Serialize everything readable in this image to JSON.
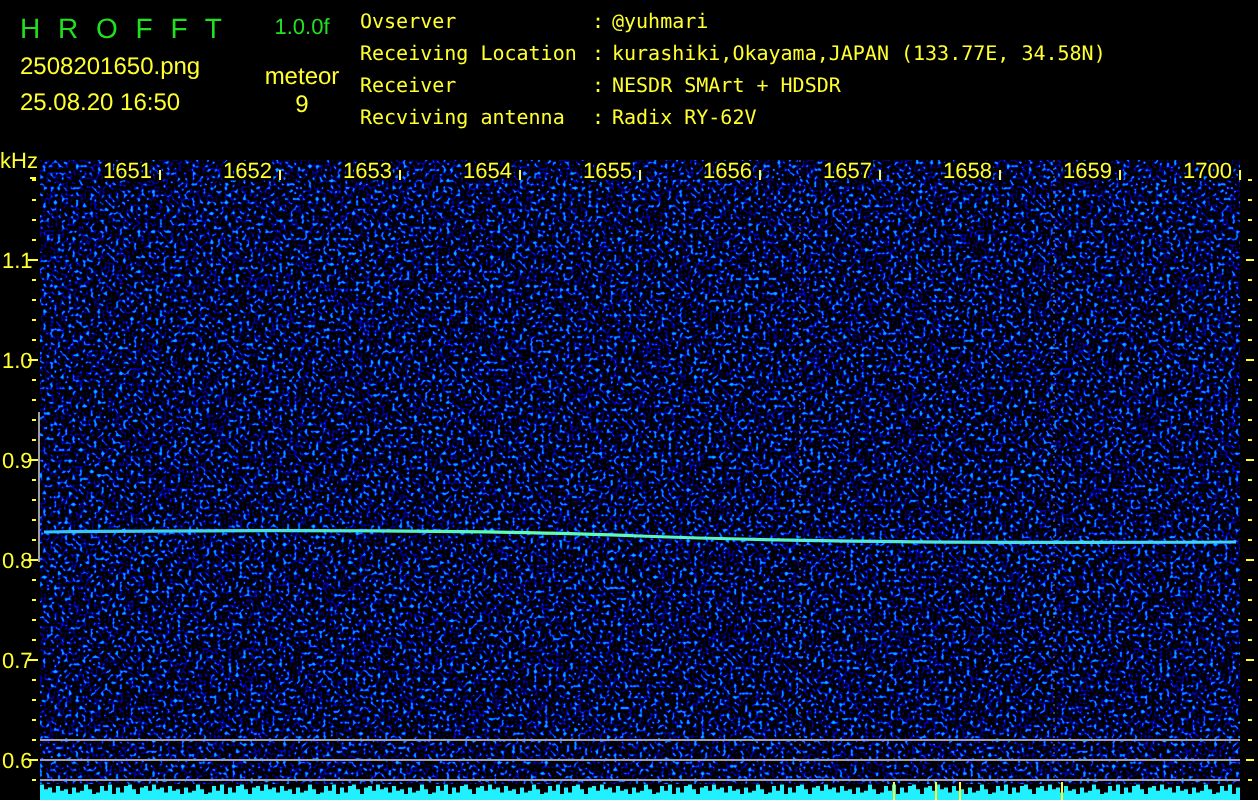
{
  "header": {
    "title": "H R O F F T",
    "version": "1.0.0f",
    "filename": "2508201650.png",
    "timestamp": "25.08.20 16:50",
    "event_label": "meteor",
    "event_count": "9"
  },
  "station_info": [
    {
      "label": "Ovserver",
      "separator": ":",
      "value": "@yuhmari"
    },
    {
      "label": "Receiving Location",
      "separator": ":",
      "value": "kurashiki,Okayama,JAPAN (133.77E, 34.58N)"
    },
    {
      "label": "Receiver",
      "separator": ":",
      "value": "NESDR SMArt + HDSDR"
    },
    {
      "label": "Recviving antenna",
      "separator": ":",
      "value": "Radix RY-62V"
    }
  ],
  "spectrogram": {
    "unit": "kHz",
    "x_ticks": [
      "1651",
      "1652",
      "1653",
      "1654",
      "1655",
      "1656",
      "1657",
      "1658",
      "1659",
      "1700"
    ],
    "y_ticks": [
      "1.1",
      "1.0",
      "0.9",
      "0.8",
      "0.7",
      "0.6"
    ]
  }
}
